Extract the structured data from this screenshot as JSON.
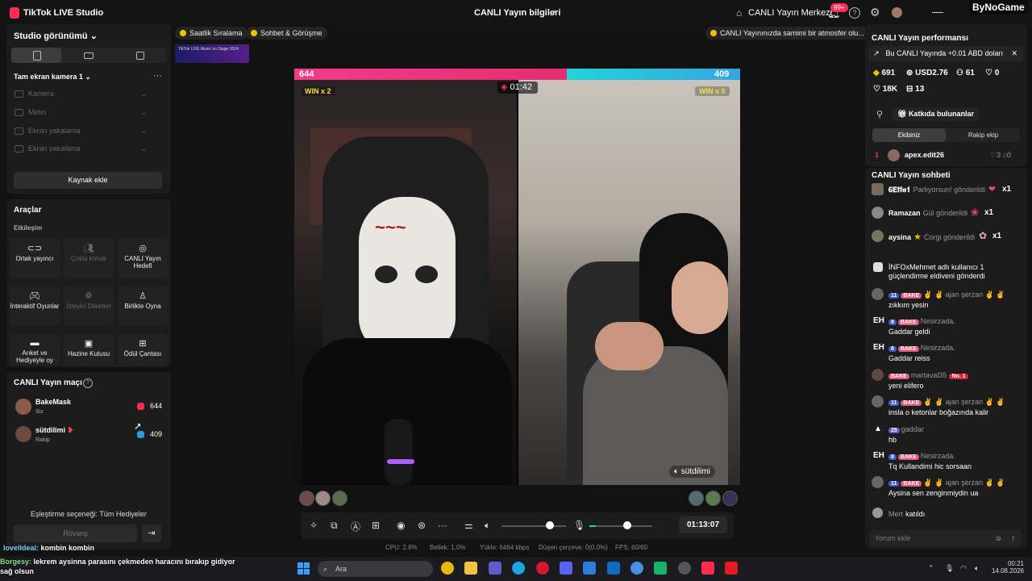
{
  "app": {
    "title": "TikTok LIVE Studio",
    "center_title": "CANLI Yayın bilgileri",
    "live_center": "CANLI Yayın Merkezi",
    "notif_badge": "99+",
    "watermark": "ByNoGame"
  },
  "left": {
    "studio_view": "Studio görünümü",
    "scene_title": "Tam ekran kamera 1",
    "sources": [
      "Kamera",
      "Metin",
      "Ekran yakalama",
      "Ekran yakalama"
    ],
    "add_source": "Kaynak ekle",
    "tools_title": "Araçlar",
    "section_label": "Etkileşim",
    "tools": [
      {
        "label": "Ortak yayıncı",
        "icon": "link-icon",
        "enabled": true
      },
      {
        "label": "Çoklu konuk",
        "icon": "guests-icon",
        "enabled": false
      },
      {
        "label": "CANLI Yayın Hedefi",
        "icon": "goal-icon",
        "enabled": true
      },
      {
        "label": "İnteraktif Oyunlar",
        "icon": "gamepad-icon",
        "enabled": true
      },
      {
        "label": "İzleyici Dilekleri",
        "icon": "wish-icon",
        "enabled": false
      },
      {
        "label": "Birlikte Oyna",
        "icon": "play-together-icon",
        "enabled": true
      },
      {
        "label": "Anket ve Hediyeyle oy",
        "icon": "poll-icon",
        "enabled": true
      },
      {
        "label": "Hazine Kutusu",
        "icon": "treasure-icon",
        "enabled": true
      },
      {
        "label": "Ödül Çantası",
        "icon": "bag-icon",
        "enabled": true
      }
    ],
    "match_title": "CANLI Yayın maçı",
    "players": [
      {
        "name": "BakeMask",
        "sub": "Siz",
        "score": "644",
        "color": "#fe2c55"
      },
      {
        "name": "sütdilimi",
        "sub": "Rakip",
        "score": "409",
        "color": "#2b9be0"
      }
    ],
    "pair_option": "Eşleştirme seçeneği: Tüm Hediyeler",
    "rematch": "Rövanş"
  },
  "pills": [
    {
      "label": "Saatlik Sıralama"
    },
    {
      "label": "Sohbet & Görüşme"
    },
    {
      "label": "CANLI Yayınınızda samimi bir atmosfer olu..."
    }
  ],
  "banner_text": "TikTok LIVE Music on Stage 2024",
  "battle": {
    "left_score": "644",
    "right_score": "409",
    "left_win": "WIN x 2",
    "right_win": "WIN x 0",
    "timer": "01:42",
    "right_name": "sütdilimi",
    "left_share": 0.611
  },
  "controls": {
    "clock": "01:13:07",
    "speaker_level": 0.75,
    "mic_level": 0.6
  },
  "stats": {
    "cpu": "CPU:  2.8%",
    "mem": "Bellek:  1.0%",
    "upload": "Yükle:  6464 kbps",
    "dropped": "Düşen çerçeve:  0(0.0%)",
    "fps": "FPS:  60/60"
  },
  "right": {
    "perf_title": "CANLI Yayın performansı",
    "earnings": "Bu CANLI Yayında +0.01 ABD doları",
    "stats": [
      {
        "icon": "diamond-icon",
        "value": "691"
      },
      {
        "icon": "coin-icon",
        "value": "USD2.76"
      },
      {
        "icon": "users-icon",
        "value": "61"
      },
      {
        "icon": "heart-icon",
        "value": "0"
      },
      {
        "icon": "heart-icon",
        "value": "18K"
      },
      {
        "icon": "viewers-icon",
        "value": "13"
      }
    ],
    "contrib": "Katkıda bulunanlar",
    "team_tab": "Ekibiniz",
    "rival_tab": "Rakip ekip",
    "rank_row": {
      "rank": "1",
      "name": "apex.edit26",
      "likes": "3",
      "gifts": "0"
    },
    "chat_title": "CANLI Yayın sohbeti",
    "gifts": [
      {
        "name": "𝟔𝐄𝐟𝐟𝐞𝟏",
        "text": "Parlıyorsun! gönderildi",
        "count": "x1"
      },
      {
        "name": "Ramazan",
        "text": "Gül gönderildi",
        "count": "x1"
      },
      {
        "name": "aysina",
        "text": "Corgi gönderildi",
        "count": "x1"
      }
    ],
    "system_msg": "İNFOxMehmet  adlı kullanıcı 1 güçlendirme eldiveni gönderdi",
    "messages": [
      {
        "lvl": "11",
        "badge": "BAKE",
        "name": "✌ ✌ ajan şerzan ✌ ✌",
        "text": "zıkkım yesin"
      },
      {
        "lvl": "8",
        "badge": "BAKE",
        "name": "Nesirzada.",
        "text": "Gaddar geldi"
      },
      {
        "lvl": "8",
        "badge": "BAKE",
        "name": "Nesirzada.",
        "text": "Gaddar reiss"
      },
      {
        "lvl": "",
        "badge": "BAKE",
        "name": "martaval35",
        "text": "yeni elifero"
      },
      {
        "lvl": "11",
        "badge": "BAKE",
        "name": "✌ ✌ ajan şerzan ✌ ✌",
        "text": "insla o ketonlar boğazında kalir"
      },
      {
        "lvl": "25",
        "badge": "",
        "name": "gaddar",
        "text": "hb"
      },
      {
        "lvl": "8",
        "badge": "BAKE",
        "name": "Nesirzada.",
        "text": "Tq Kullandimi hic sorsaan"
      },
      {
        "lvl": "11",
        "badge": "BAKE",
        "name": "✌ ✌ ajan şerzan ✌ ✌",
        "text": "Aysina sen zenginmiydin ua"
      }
    ],
    "no1_badge": "No. 1",
    "join_name": "Mert",
    "join_text": "katıldı",
    "comment_placeholder": "Yorum ekle"
  },
  "overlay": {
    "line1_user": "lovelldeal:",
    "line1_text": "kombin kombin",
    "line2_user": "Borgesy:",
    "line2_text": "lekrem aysinna parasını çekmeden haracını bırakıp gidiyor sağ olsun"
  },
  "taskbar": {
    "search": "Ara",
    "time": "00:21",
    "date": "14.08.2026"
  }
}
